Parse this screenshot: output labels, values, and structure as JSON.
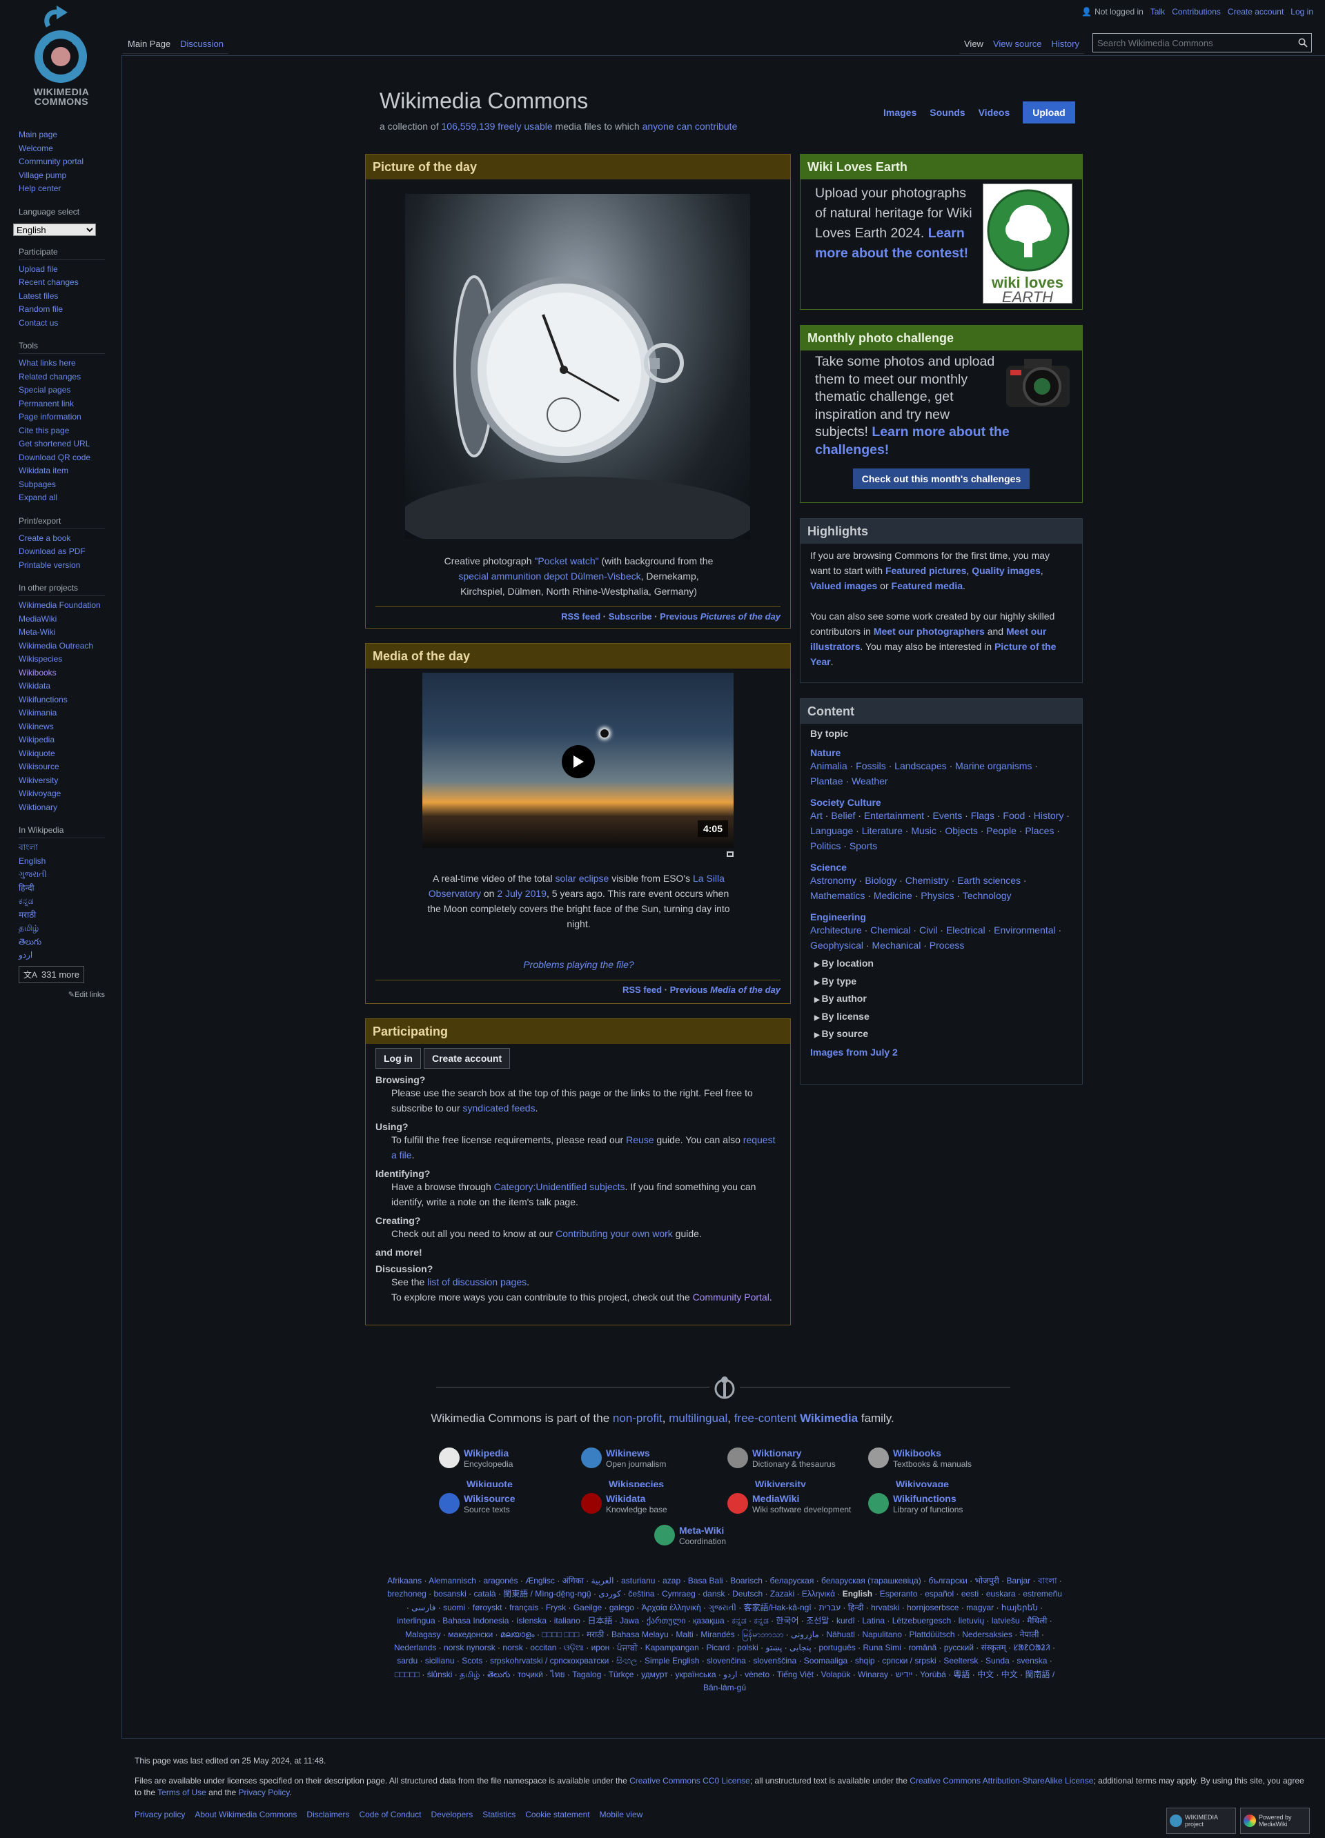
{
  "top_links": {
    "not_logged_in": "Not logged in",
    "talk": "Talk",
    "contributions": "Contributions",
    "create_account": "Create account",
    "log_in": "Log in"
  },
  "tabs": {
    "main_page": "Main Page",
    "discussion": "Discussion",
    "view": "View",
    "view_source": "View source",
    "history": "History"
  },
  "search": {
    "placeholder": "Search Wikimedia Commons"
  },
  "logo_text": "WIKIMEDIA COMMONS",
  "sidebar": {
    "nav": [
      "Main page",
      "Welcome",
      "Community portal",
      "Village pump",
      "Help center"
    ],
    "language_select": "Language select",
    "language_value": "English",
    "participate_head": "Participate",
    "participate": [
      "Upload file",
      "Recent changes",
      "Latest files",
      "Random file",
      "Contact us"
    ],
    "tools_head": "Tools",
    "tools": [
      "What links here",
      "Related changes",
      "Special pages",
      "Permanent link",
      "Page information",
      "Cite this page",
      "Get shortened URL",
      "Download QR code",
      "Wikidata item",
      "Subpages",
      "Expand all"
    ],
    "print_head": "Print/export",
    "print": [
      "Create a book",
      "Download as PDF",
      "Printable version"
    ],
    "other_head": "In other projects",
    "other": [
      "Wikimedia Foundation",
      "MediaWiki",
      "Meta-Wiki",
      "Wikimedia Outreach",
      "Wikispecies",
      "Wikibooks",
      "Wikidata",
      "Wikifunctions",
      "Wikimania",
      "Wikinews",
      "Wikipedia",
      "Wikiquote",
      "Wikisource",
      "Wikiversity",
      "Wikivoyage",
      "Wiktionary"
    ],
    "inwiki_head": "In Wikipedia",
    "inwiki": [
      "বাংলা",
      "English",
      "ગુજરાતી",
      "हिन्दी",
      "ಕನ್ನಡ",
      "मराठी",
      "தமிழ்",
      "తెలుగు",
      "اردو"
    ],
    "more": "331 more",
    "edit_links": "Edit links"
  },
  "header": {
    "title": "Wikimedia Commons",
    "sub_a": "a collection of ",
    "count": "106,559,139",
    "sub_b": " freely usable",
    "sub_c": " media files to which ",
    "sub_d": "anyone can contribute",
    "nav": [
      "Images",
      "Sounds",
      "Videos"
    ],
    "upload": "Upload"
  },
  "potd": {
    "title": "Picture of the day",
    "cap1": "Creative photograph ",
    "cap_l1": "\"Pocket watch\"",
    "cap2": " (with background from the",
    "cap_l2": "special ammunition depot Dülmen-Visbeck",
    "cap3": ", Dernekamp,",
    "cap4": "Kirchspiel, Dülmen, North Rhine-Westphalia, Germany)",
    "rss": "RSS feed",
    "subscribe": "Subscribe",
    "previous": "Previous ",
    "previous_i": "Pictures of the day"
  },
  "motd": {
    "title": "Media of the day",
    "duration": "4:05",
    "cap1": "A real-time video of the total ",
    "cap_l1": "solar eclipse",
    "cap2": " visible from ESO's ",
    "cap_l2": "La Silla",
    "cap_l3": "Observatory",
    "cap3": " on ",
    "cap_l4": "2 July 2019",
    "cap4": ", 5 years ago. This rare event occurs when",
    "cap5": "the Moon completely covers the bright face of the Sun, turning day into",
    "cap6": "night.",
    "problems": "Problems playing the file?",
    "rss": "RSS feed",
    "previous": "Previous ",
    "previous_i": "Media of the day"
  },
  "participating": {
    "title": "Participating",
    "login": "Log in",
    "create": "Create account",
    "browsing": "Browsing?",
    "browsing_a": "Please use the search box at the top of this page or the links to the right. Feel free to",
    "browsing_b": "subscribe to our ",
    "browsing_l": "syndicated feeds",
    "using": "Using?",
    "using_a": "To fulfill the free license requirements, please read our ",
    "using_l": "Reuse",
    "using_b": " guide. You can also ",
    "using_l2": "request",
    "using_l3": "a file",
    "identifying": "Identifying?",
    "ident_a": "Have a browse through ",
    "ident_l": "Category:Unidentified subjects",
    "ident_b": ". If you find something you can",
    "ident_c": "identify, write a note on the item's talk page.",
    "creating": "Creating?",
    "creating_a": "Check out all you need to know at our ",
    "creating_l": "Contributing your own work",
    "creating_b": " guide.",
    "more": "and more!",
    "discussion": "Discussion?",
    "disc_a": "See the ",
    "disc_l": "list of discussion pages",
    "disc_b": "To explore more ways you can contribute to this project, check out the ",
    "disc_l2": "Community Portal"
  },
  "wle": {
    "title": "Wiki Loves Earth",
    "t1": "Upload your photographs",
    "t2": "of natural heritage for Wiki",
    "t3": "Loves Earth 2024. ",
    "l1": "Learn",
    "l2": "more about the contest!",
    "logo1": "wiki loves",
    "logo2": "EARTH"
  },
  "mpc": {
    "title": "Monthly photo challenge",
    "t1": "Take some photos and upload",
    "t2": "them to meet our monthly",
    "t3": "thematic challenge, get",
    "t4": "inspiration and try new",
    "t5": "subjects! ",
    "l1": "Learn more about the",
    "l2": "challenges!",
    "button": "Check out this month's challenges"
  },
  "highlights": {
    "title": "Highlights",
    "p1a": "If you are browsing Commons for the first time, you may",
    "p1b": "want to start with ",
    "l1": "Featured pictures",
    "l2": "Quality images",
    "l3": "Valued images",
    "or": " or ",
    "l4": "Featured media",
    "p2a": "You can also see some work created by our highly skilled",
    "p2b": "contributors in ",
    "l5": "Meet our photographers",
    "and": " and ",
    "l6": "Meet our",
    "l7": "illustrators",
    "p2c": ". You may also be interested in ",
    "l8": "Picture of the",
    "l9": "Year"
  },
  "content": {
    "title": "Content",
    "by_topic": "By topic",
    "nature": "Nature",
    "nature_items": [
      "Animalia",
      "Fossils",
      "Landscapes",
      "Marine organisms",
      "Plantae",
      "Weather"
    ],
    "society": "Society  Culture",
    "society_items": [
      "Art",
      "Belief",
      "Entertainment",
      "Events",
      "Flags",
      "Food",
      "History",
      "Language",
      "Literature",
      "Music",
      "Objects",
      "People",
      "Places",
      "Politics",
      "Sports"
    ],
    "science": "Science",
    "science_items": [
      "Astronomy",
      "Biology",
      "Chemistry",
      "Earth sciences",
      "Mathematics",
      "Medicine",
      "Physics",
      "Technology"
    ],
    "engineering": "Engineering",
    "engineering_items": [
      "Architecture",
      "Chemical",
      "Civil",
      "Electrical",
      "Environmental",
      "Geophysical",
      "Mechanical",
      "Process"
    ],
    "toggles": [
      "By location",
      "By type",
      "By author",
      "By license",
      "By source"
    ],
    "images_from": "Images from July 2"
  },
  "family": {
    "a": "Wikimedia Commons is part of the ",
    "l1": "non-profit",
    "c": ", ",
    "l2": "multilingual",
    "l3": "free-content",
    "l4": "Wikimedia",
    "b": " family."
  },
  "projects": [
    {
      "name": "Wikipedia",
      "desc": "Encyclopedia",
      "color": "#e8e8e8"
    },
    {
      "name": "Wikinews",
      "desc": "Open journalism",
      "color": "#3a7fc1"
    },
    {
      "name": "Wiktionary",
      "desc": "Dictionary & thesaurus",
      "color": "#888888"
    },
    {
      "name": "Wikibooks",
      "desc": "Textbooks & manuals",
      "color": "#9a9a9a"
    },
    {
      "name": "Wikisource",
      "desc": "Source texts",
      "color": "#3366cc"
    },
    {
      "name": "Wikidata",
      "desc": "Knowledge base",
      "color": "#990000"
    },
    {
      "name": "MediaWiki",
      "desc": "Wiki software development",
      "color": "#d33"
    },
    {
      "name": "Wikifunctions",
      "desc": "Library of functions",
      "color": "#339966"
    },
    {
      "name": "Meta-Wiki",
      "desc": "Coordination",
      "color": "#339966"
    }
  ],
  "projects_hidden": [
    "Wikiquote",
    "Wikispecies",
    "Wikiversity",
    "Wikivoyage"
  ],
  "languages": [
    "Afrikaans",
    "Alemannisch",
    "aragonés",
    "Ænglisc",
    "अंगिका",
    "العربية",
    "asturianu",
    "azap",
    "Basa Bali",
    "Boarisch",
    "беларуская",
    "беларуская (тарашкевіца)",
    "български",
    "भोजपुरी",
    "Banjar",
    "বাংলা",
    "brezhoneg",
    "bosanski",
    "català",
    "閩東語 / Mìng-dĕ̤ng-ngṳ̄",
    "کوردی",
    "čeština",
    "Cymraeg",
    "dansk",
    "Deutsch",
    "Zazaki",
    "Ελληνικά",
    "English",
    "Esperanto",
    "español",
    "eesti",
    "euskara",
    "estremeñu",
    "فارسی",
    "suomi",
    "føroyskt",
    "français",
    "Frysk",
    "Gaeilge",
    "galego",
    "Ἀρχαία ἑλληνικὴ",
    "ગુજરાતી",
    "客家語/Hak-kâ-ngî",
    "עברית",
    "हिन्दी",
    "hrvatski",
    "hornjoserbsce",
    "magyar",
    "հայերեն",
    "interlingua",
    "Bahasa Indonesia",
    "íslenska",
    "italiano",
    "日本語",
    "Jawa",
    "ქართული",
    "қазақша",
    "ಕನ್ನಡ",
    "ಕನ್ನಡ",
    "한국어",
    "조선말",
    "kurdî",
    "Latina",
    "Lëtzebuergesch",
    "lietuvių",
    "latviešu",
    "मैथिली",
    "Malagasy",
    "македонски",
    "മലയാളം",
    "□□□□ □□□",
    "मराठी",
    "Bahasa Melayu",
    "Malti",
    "Mirandés",
    "မြန်မာဘာသာ",
    "مازِرونی",
    "Nāhuatl",
    "Napulitano",
    "Plattdüütsch",
    "Nedersaksies",
    "नेपाली",
    "Nederlands",
    "norsk nynorsk",
    "norsk",
    "occitan",
    "ଓଡ଼ିଆ",
    "ирон",
    "ਪੰਜਾਬੀ",
    "Kapampangan",
    "Picard",
    "polski",
    "پنجابی",
    "پښتو",
    "português",
    "Runa Simi",
    "română",
    "русский",
    "संस्कृतम्",
    "ᱥᱟᱱᱛᱟᱲᱤ",
    "sardu",
    "sicilianu",
    "Scots",
    "srpskohrvatski / српскохрватски",
    "සිංහල",
    "Simple English",
    "slovenčina",
    "slovenščina",
    "Soomaaliga",
    "shqip",
    "српски / srpski",
    "Seeltersk",
    "Sunda",
    "svenska",
    "□□□□□",
    "ślůnski",
    "தமிழ்",
    "తెలుగు",
    "тоҷикӣ",
    "ไทย",
    "Tagalog",
    "Türkçe",
    "удмурт",
    "українська",
    "اردو",
    "vèneto",
    "Tiếng Việt",
    "Volapük",
    "Winaray",
    "ייִדיש",
    "Yorùbá",
    "粵語",
    "中文",
    "中文",
    "閩南語 / Bân-lâm-gú"
  ],
  "footer": {
    "edited": "This page was last edited on 25 May 2024, at 11:48.",
    "lic_a": "Files are available under licenses specified on their description page. All structured data from the file namespace is available under the ",
    "lic_l1": "Creative Commons CC0 License",
    "lic_b": "; all unstructured text is available under the ",
    "lic_l2": "Creative Commons Attribution-ShareAlike License",
    "lic_c": "; additional terms may apply. By using this site, you agree",
    "lic_d": "to the ",
    "lic_l3": "Terms of Use",
    "lic_e": " and the ",
    "lic_l4": "Privacy Policy",
    "links": [
      "Privacy policy",
      "About Wikimedia Commons",
      "Disclaimers",
      "Code of Conduct",
      "Developers",
      "Statistics",
      "Cookie statement",
      "Mobile view"
    ],
    "badge1": "WIKIMEDIA project",
    "badge2": "Powered by MediaWiki"
  }
}
